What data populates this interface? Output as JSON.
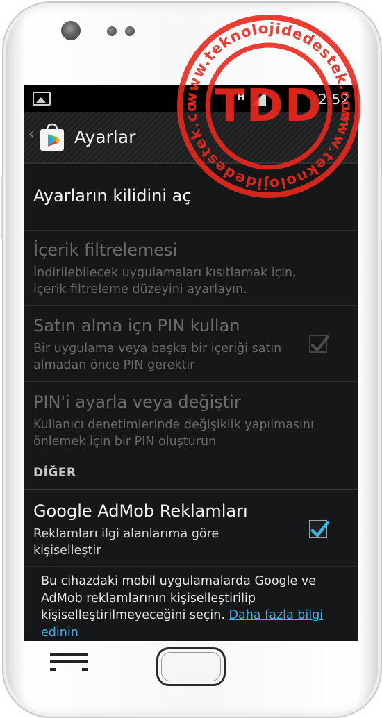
{
  "status_bar": {
    "network": "H",
    "time": "2:52"
  },
  "action_bar": {
    "title": "Ayarlar"
  },
  "settings": [
    {
      "title": "Ayarların kilidini aç",
      "summary": "",
      "enabled": true
    },
    {
      "title": "İçerik filtrelemesi",
      "summary": "İndirilebilecek uygulamaları kısıtlamak için, içerik filtreleme düzeyini ayarlayın.",
      "enabled": false
    },
    {
      "title": "Satın alma içn PIN kullan",
      "summary": "Bir uygulama veya başka bir içeriği satın almadan önce PIN gerektir",
      "enabled": false,
      "checked": true
    },
    {
      "title": "PIN'i ayarla veya değiştir",
      "summary": "Kullanıcı denetimlerinde değişiklik yapılmasını önlemek için bir PIN oluşturun",
      "enabled": false
    }
  ],
  "category": "DİĞER",
  "admob": {
    "title": "Google AdMob Reklamları",
    "summary": "Reklamları ilgi alanlarıma göre kişiselleştir",
    "checked": true
  },
  "footer": {
    "text": "Bu cihazdaki mobil uygulamalarda Google ve AdMob reklamlarının kişiselleştirilip kişiselleştirilmeyeceğini seçin. ",
    "link": "Daha fazla bilgi edinin"
  },
  "watermark": {
    "brand": "TDD",
    "url": "www.teknolojidedestek.com",
    "color": "#e8281e"
  },
  "colors": {
    "accent": "#3fb2e8",
    "screen_bg": "#161718"
  },
  "icons": [
    "gallery-icon",
    "signal-icon",
    "back-chevron-icon",
    "play-store-icon",
    "checkmark-icon",
    "menu-key-icon",
    "home-key"
  ]
}
